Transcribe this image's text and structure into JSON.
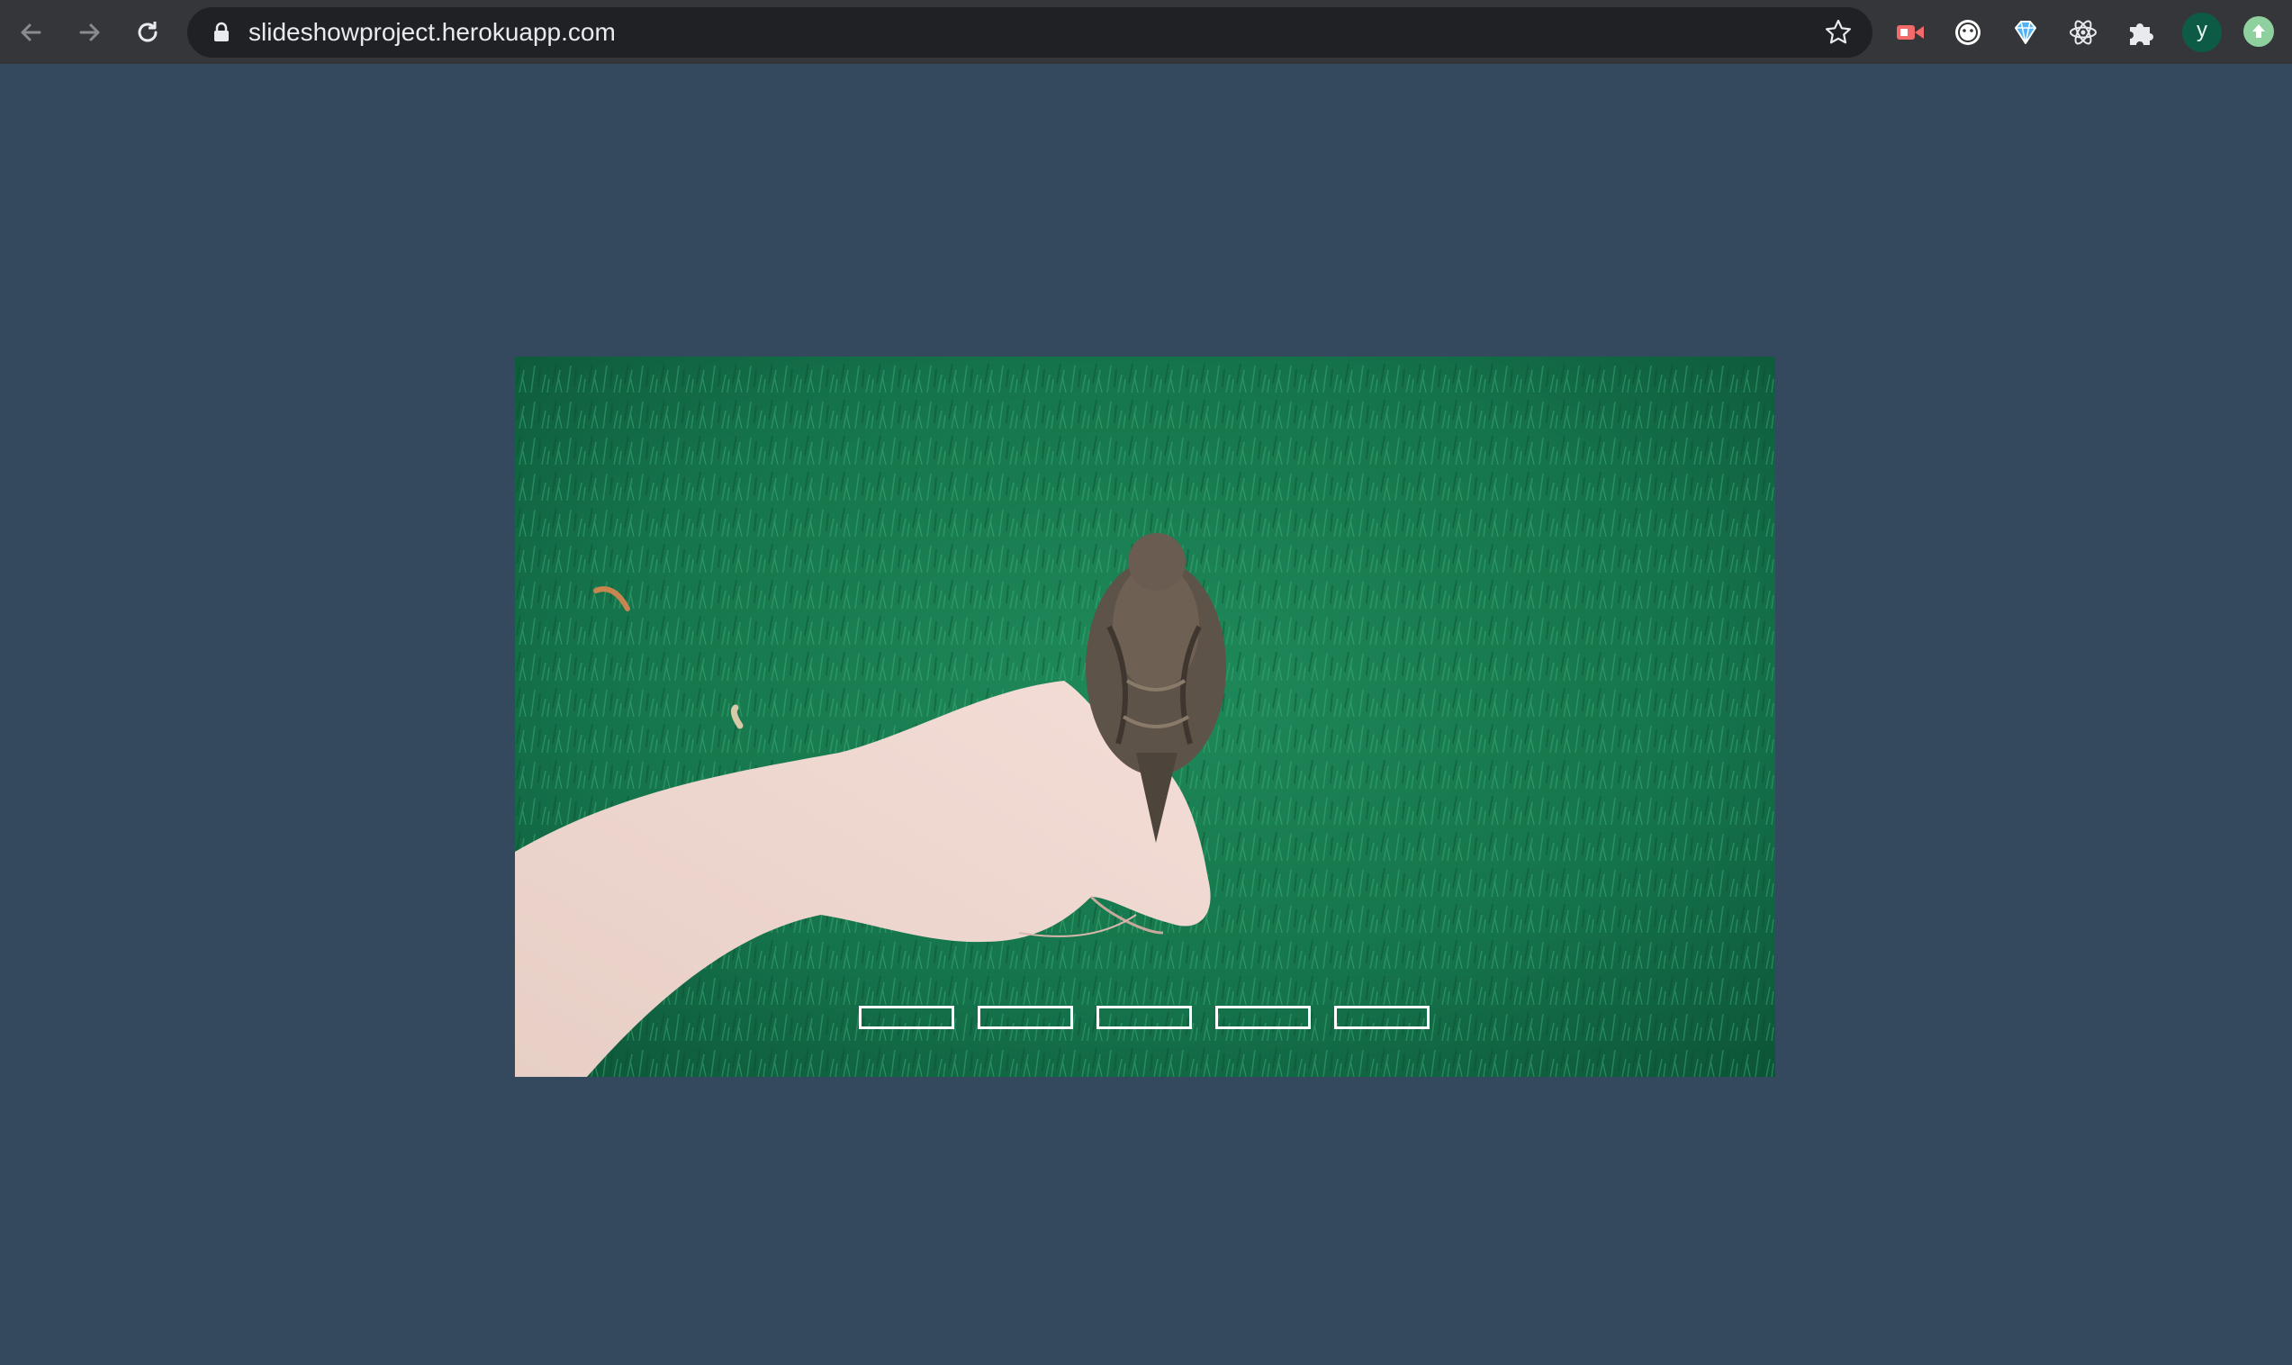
{
  "browser": {
    "url": "slideshowproject.herokuapp.com",
    "icons": {
      "back": "back-arrow-icon",
      "forward": "forward-arrow-icon",
      "reload": "reload-icon",
      "lock": "lock-icon",
      "bookmark": "star-icon"
    },
    "extensions": [
      "screen-recorder-icon",
      "face-icon",
      "diamond-icon",
      "react-atom-icon",
      "puzzle-icon"
    ],
    "profile_initial": "y"
  },
  "slideshow": {
    "image_subject": "bird perched on hand over green grass",
    "indicator_count": 5,
    "indicator_color": "#ffffff"
  },
  "colors": {
    "page_background": "#34495e",
    "toolbar": "#35363a",
    "omnibox": "#202124"
  }
}
